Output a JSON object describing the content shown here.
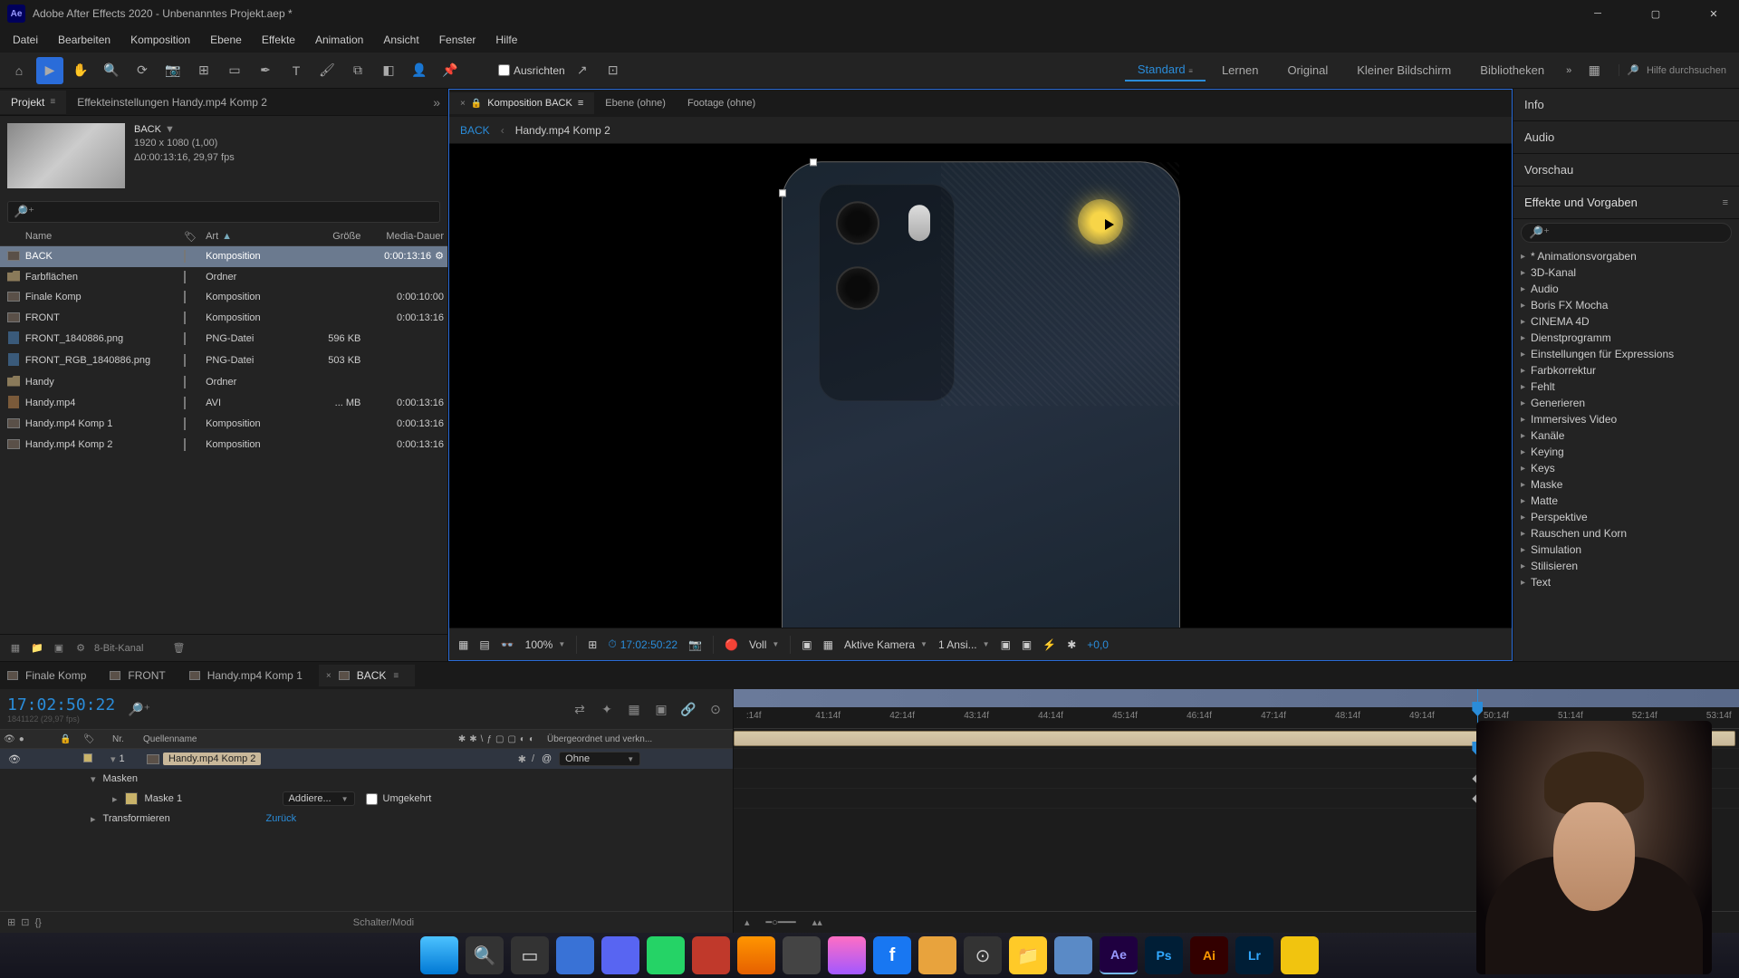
{
  "titlebar": {
    "app": "Ae",
    "title": "Adobe After Effects 2020 - Unbenanntes Projekt.aep *"
  },
  "menu": [
    "Datei",
    "Bearbeiten",
    "Komposition",
    "Ebene",
    "Effekte",
    "Animation",
    "Ansicht",
    "Fenster",
    "Hilfe"
  ],
  "toolbar": {
    "ausrichten": "Ausrichten",
    "workspaces": [
      "Standard",
      "Lernen",
      "Original",
      "Kleiner Bildschirm",
      "Bibliotheken"
    ],
    "active_workspace": 0,
    "search_placeholder": "Hilfe durchsuchen"
  },
  "project_panel": {
    "tabs": {
      "projekt": "Projekt",
      "effekt": "Effekteinstellungen  Handy.mp4 Komp 2"
    },
    "selected_item": {
      "name": "BACK",
      "dims": "1920 x 1080 (1,00)",
      "time": "Δ0:00:13:16, 29,97 fps"
    },
    "columns": {
      "name": "Name",
      "art": "Art",
      "groesse": "Größe",
      "dauer": "Media-Dauer"
    },
    "items": [
      {
        "icon": "comp",
        "name": "BACK",
        "art": "Komposition",
        "size": "",
        "dur": "0:00:13:16",
        "sel": true,
        "extra": "⚙"
      },
      {
        "icon": "folder",
        "name": "Farbflächen",
        "art": "Ordner",
        "size": "",
        "dur": ""
      },
      {
        "icon": "comp",
        "name": "Finale Komp",
        "art": "Komposition",
        "size": "",
        "dur": "0:00:10:00"
      },
      {
        "icon": "comp",
        "name": "FRONT",
        "art": "Komposition",
        "size": "",
        "dur": "0:00:13:16"
      },
      {
        "icon": "png",
        "name": "FRONT_1840886.png",
        "art": "PNG-Datei",
        "size": "596 KB",
        "dur": ""
      },
      {
        "icon": "png",
        "name": "FRONT_RGB_1840886.png",
        "art": "PNG-Datei",
        "size": "503 KB",
        "dur": ""
      },
      {
        "icon": "folder",
        "name": "Handy",
        "art": "Ordner",
        "size": "",
        "dur": ""
      },
      {
        "icon": "avi",
        "name": "Handy.mp4",
        "art": "AVI",
        "size": "... MB",
        "dur": "0:00:13:16"
      },
      {
        "icon": "comp",
        "name": "Handy.mp4 Komp 1",
        "art": "Komposition",
        "size": "",
        "dur": "0:00:13:16"
      },
      {
        "icon": "comp",
        "name": "Handy.mp4 Komp 2",
        "art": "Komposition",
        "size": "",
        "dur": "0:00:13:16"
      }
    ],
    "footer_bpc": "8-Bit-Kanal"
  },
  "comp_panel": {
    "tabs": {
      "komp": "Komposition BACK",
      "ebene": "Ebene (ohne)",
      "footage": "Footage (ohne)"
    },
    "breadcrumbs": [
      "BACK",
      "Handy.mp4 Komp 2"
    ],
    "footer": {
      "zoom": "100%",
      "timecode": "17:02:50:22",
      "res": "Voll",
      "camera": "Aktive Kamera",
      "views": "1 Ansi...",
      "exposure": "+0,0"
    }
  },
  "right": {
    "panels": [
      "Info",
      "Audio",
      "Vorschau",
      "Effekte und Vorgaben"
    ],
    "effects_categories": [
      "* Animationsvorgaben",
      "3D-Kanal",
      "Audio",
      "Boris FX Mocha",
      "CINEMA 4D",
      "Dienstprogramm",
      "Einstellungen für Expressions",
      "Farbkorrektur",
      "Fehlt",
      "Generieren",
      "Immersives Video",
      "Kanäle",
      "Keying",
      "Keys",
      "Maske",
      "Matte",
      "Perspektive",
      "Rauschen und Korn",
      "Simulation",
      "Stilisieren",
      "Text"
    ]
  },
  "timeline": {
    "tabs": [
      "Finale Komp",
      "FRONT",
      "Handy.mp4 Komp 1",
      "BACK"
    ],
    "active_tab": 3,
    "current_time": "17:02:50:22",
    "frame_info": "1841122 (29,97 fps)",
    "columns": {
      "nr": "Nr.",
      "name": "Quellenname",
      "parent": "Übergeordnet und verkn..."
    },
    "layers": [
      {
        "nr": 1,
        "name": "Handy.mp4 Komp 2",
        "parent": "Ohne"
      }
    ],
    "sub": {
      "masken": "Masken",
      "maske1": "Maske 1",
      "mode": "Addiere...",
      "invert": "Umgekehrt",
      "transform": "Transformieren",
      "reset": "Zurück"
    },
    "ruler_marks": [
      ":14f",
      "41:14f",
      "42:14f",
      "43:14f",
      "44:14f",
      "45:14f",
      "46:14f",
      "47:14f",
      "48:14f",
      "49:14f",
      "50:14f",
      "51:14f",
      "52:14f",
      "53:14f"
    ],
    "footer": "Schalter/Modi"
  },
  "taskbar": {
    "apps": [
      "win",
      "search",
      "tasks",
      "app1",
      "purple",
      "wa",
      "red",
      "ff",
      "grey",
      "msg",
      "fb",
      "journal",
      "obs",
      "folder",
      "edit",
      "ae",
      "ps",
      "ai",
      "lr",
      "yellow"
    ]
  }
}
